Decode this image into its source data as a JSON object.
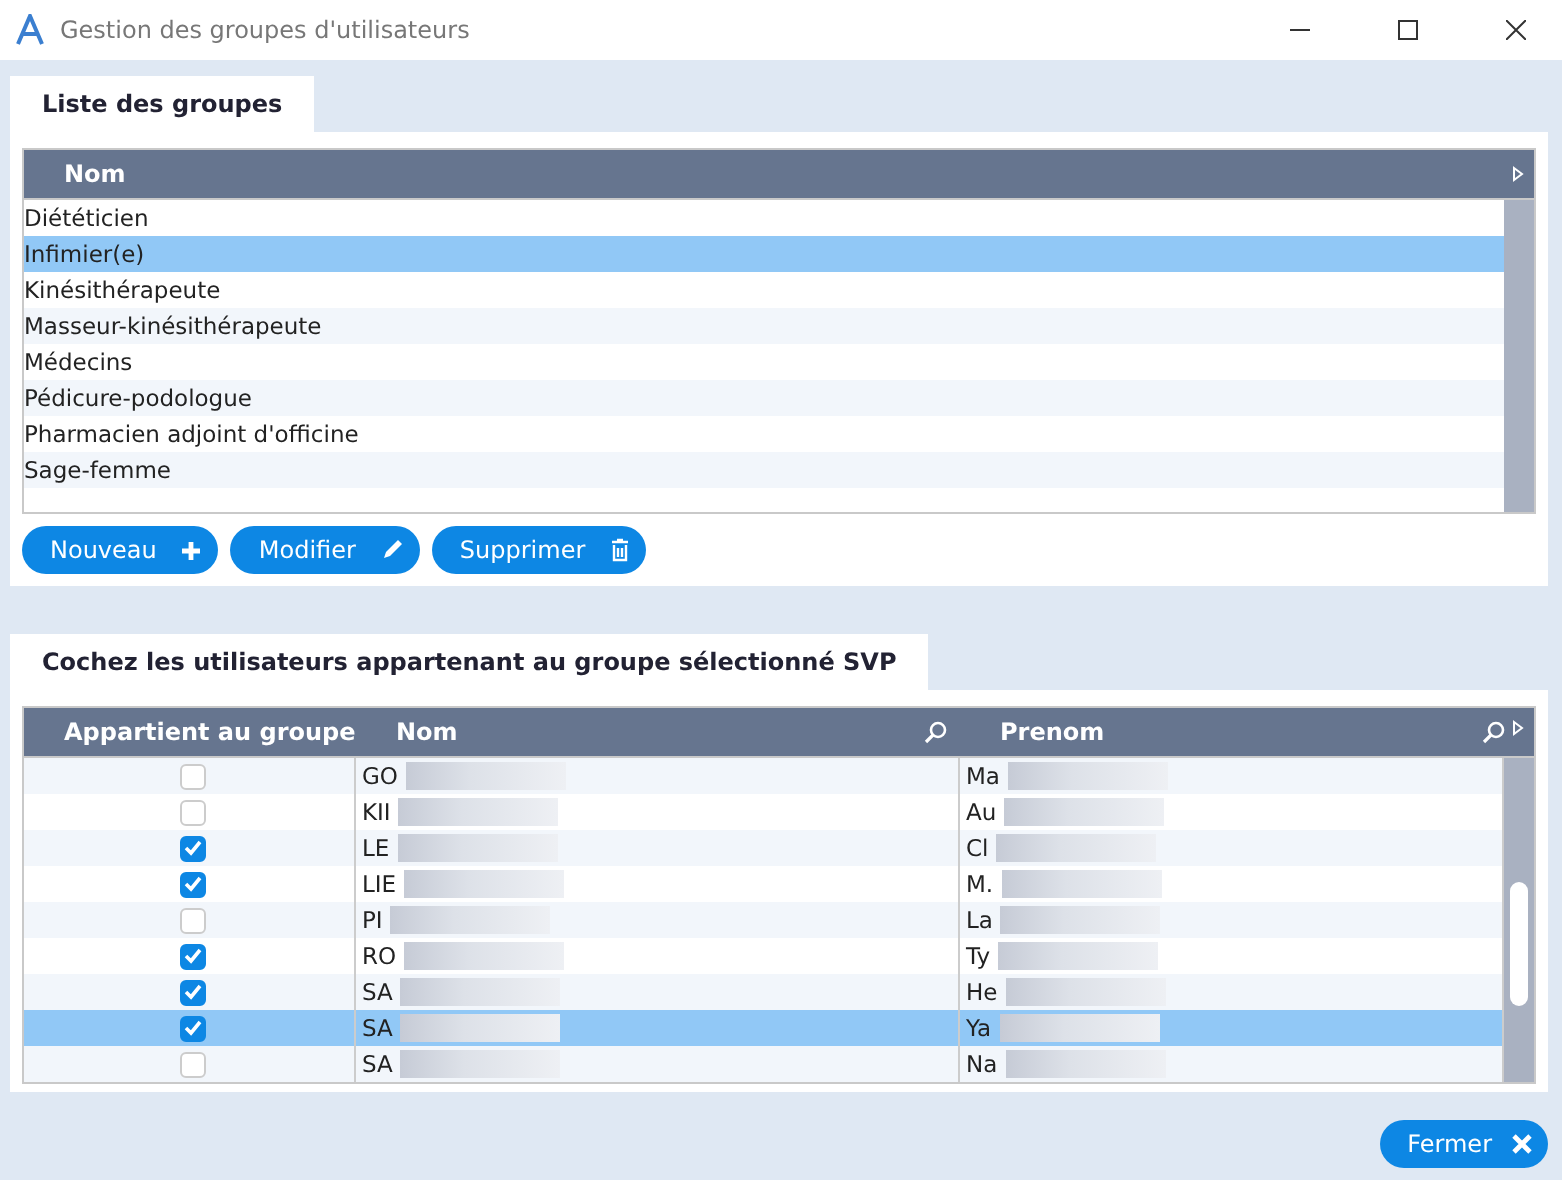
{
  "window": {
    "title": "Gestion des groupes d'utilisateurs"
  },
  "groups_panel": {
    "tab": "Liste des groupes",
    "column": "Nom",
    "rows": [
      {
        "name": "Diététicien",
        "selected": false
      },
      {
        "name": "Infimier(e)",
        "selected": true
      },
      {
        "name": "Kinésithérapeute",
        "selected": false
      },
      {
        "name": "Masseur-kinésithérapeute",
        "selected": false
      },
      {
        "name": "Médecins",
        "selected": false
      },
      {
        "name": "Pédicure-podologue",
        "selected": false
      },
      {
        "name": "Pharmacien adjoint d'officine",
        "selected": false
      },
      {
        "name": "Sage-femme",
        "selected": false
      }
    ],
    "buttons": [
      {
        "label": "Nouveau",
        "kind": "add"
      },
      {
        "label": "Modifier",
        "kind": "edit"
      },
      {
        "label": "Supprimer",
        "kind": "delete"
      }
    ]
  },
  "users_panel": {
    "tab": "Cochez les utilisateurs appartenant au groupe sélectionné SVP",
    "columns": [
      "Appartient au groupe",
      "Nom",
      "Prenom"
    ],
    "rows": [
      {
        "nom": "GO",
        "prenom": "Ma",
        "checked": false,
        "selected": false
      },
      {
        "nom": "KII",
        "prenom": "Au",
        "checked": false,
        "selected": false
      },
      {
        "nom": "LE",
        "prenom": "Cl",
        "checked": true,
        "selected": false
      },
      {
        "nom": "LIE",
        "prenom": "M.",
        "checked": true,
        "selected": false
      },
      {
        "nom": "PI",
        "prenom": "La",
        "checked": false,
        "selected": false
      },
      {
        "nom": "RO",
        "prenom": "Ty",
        "checked": true,
        "selected": false
      },
      {
        "nom": "SA",
        "prenom": "He",
        "checked": true,
        "selected": false
      },
      {
        "nom": "SA",
        "prenom": "Ya",
        "checked": true,
        "selected": true
      },
      {
        "nom": "SA",
        "prenom": "Na",
        "checked": false,
        "selected": false
      }
    ]
  },
  "close_button": {
    "label": "Fermer"
  }
}
